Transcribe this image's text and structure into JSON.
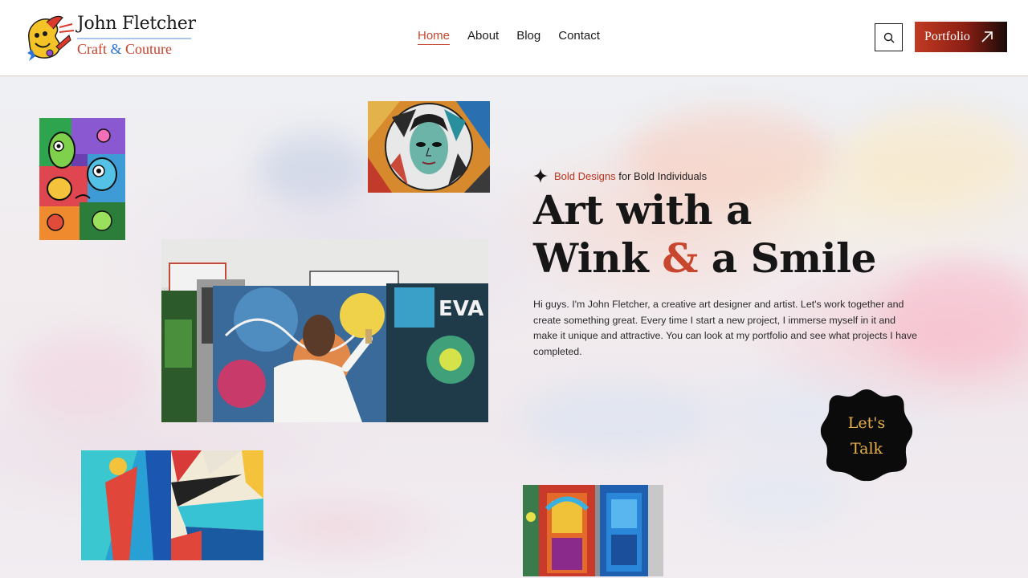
{
  "brand": {
    "name": "John Fletcher",
    "tagline_part1": "Craft",
    "tagline_amp": "&",
    "tagline_part2": "Couture"
  },
  "nav": {
    "items": [
      {
        "label": "Home",
        "active": true
      },
      {
        "label": "About",
        "active": false
      },
      {
        "label": "Blog",
        "active": false
      },
      {
        "label": "Contact",
        "active": false
      }
    ]
  },
  "header_actions": {
    "search_icon": "search-icon",
    "portfolio_label": "Portfolio",
    "portfolio_icon": "arrow-up-right-icon"
  },
  "hero": {
    "tagline_accent": "Bold Designs",
    "tagline_rest": "for Bold Individuals",
    "tagline_icon": "sparkle-icon",
    "headline_line1": "Art with a",
    "headline_line2_start": "Wink",
    "headline_amp": "&",
    "headline_line2_end": "a Smile",
    "intro": "Hi guys. I'm John Fletcher, a creative art designer and artist. Let's work together and create something great. Every time I start a new project, I immerse myself in it and make it unique and attractive. You can look at my portfolio and see what projects I have completed.",
    "cta_line1": "Let's",
    "cta_line2": "Talk"
  },
  "colors": {
    "accent": "#c8462e",
    "portfolio_gradient_start": "#c23a22",
    "portfolio_gradient_end": "#1a0b08",
    "badge_bg": "#0b0b0b",
    "badge_text": "#e8b24a"
  }
}
